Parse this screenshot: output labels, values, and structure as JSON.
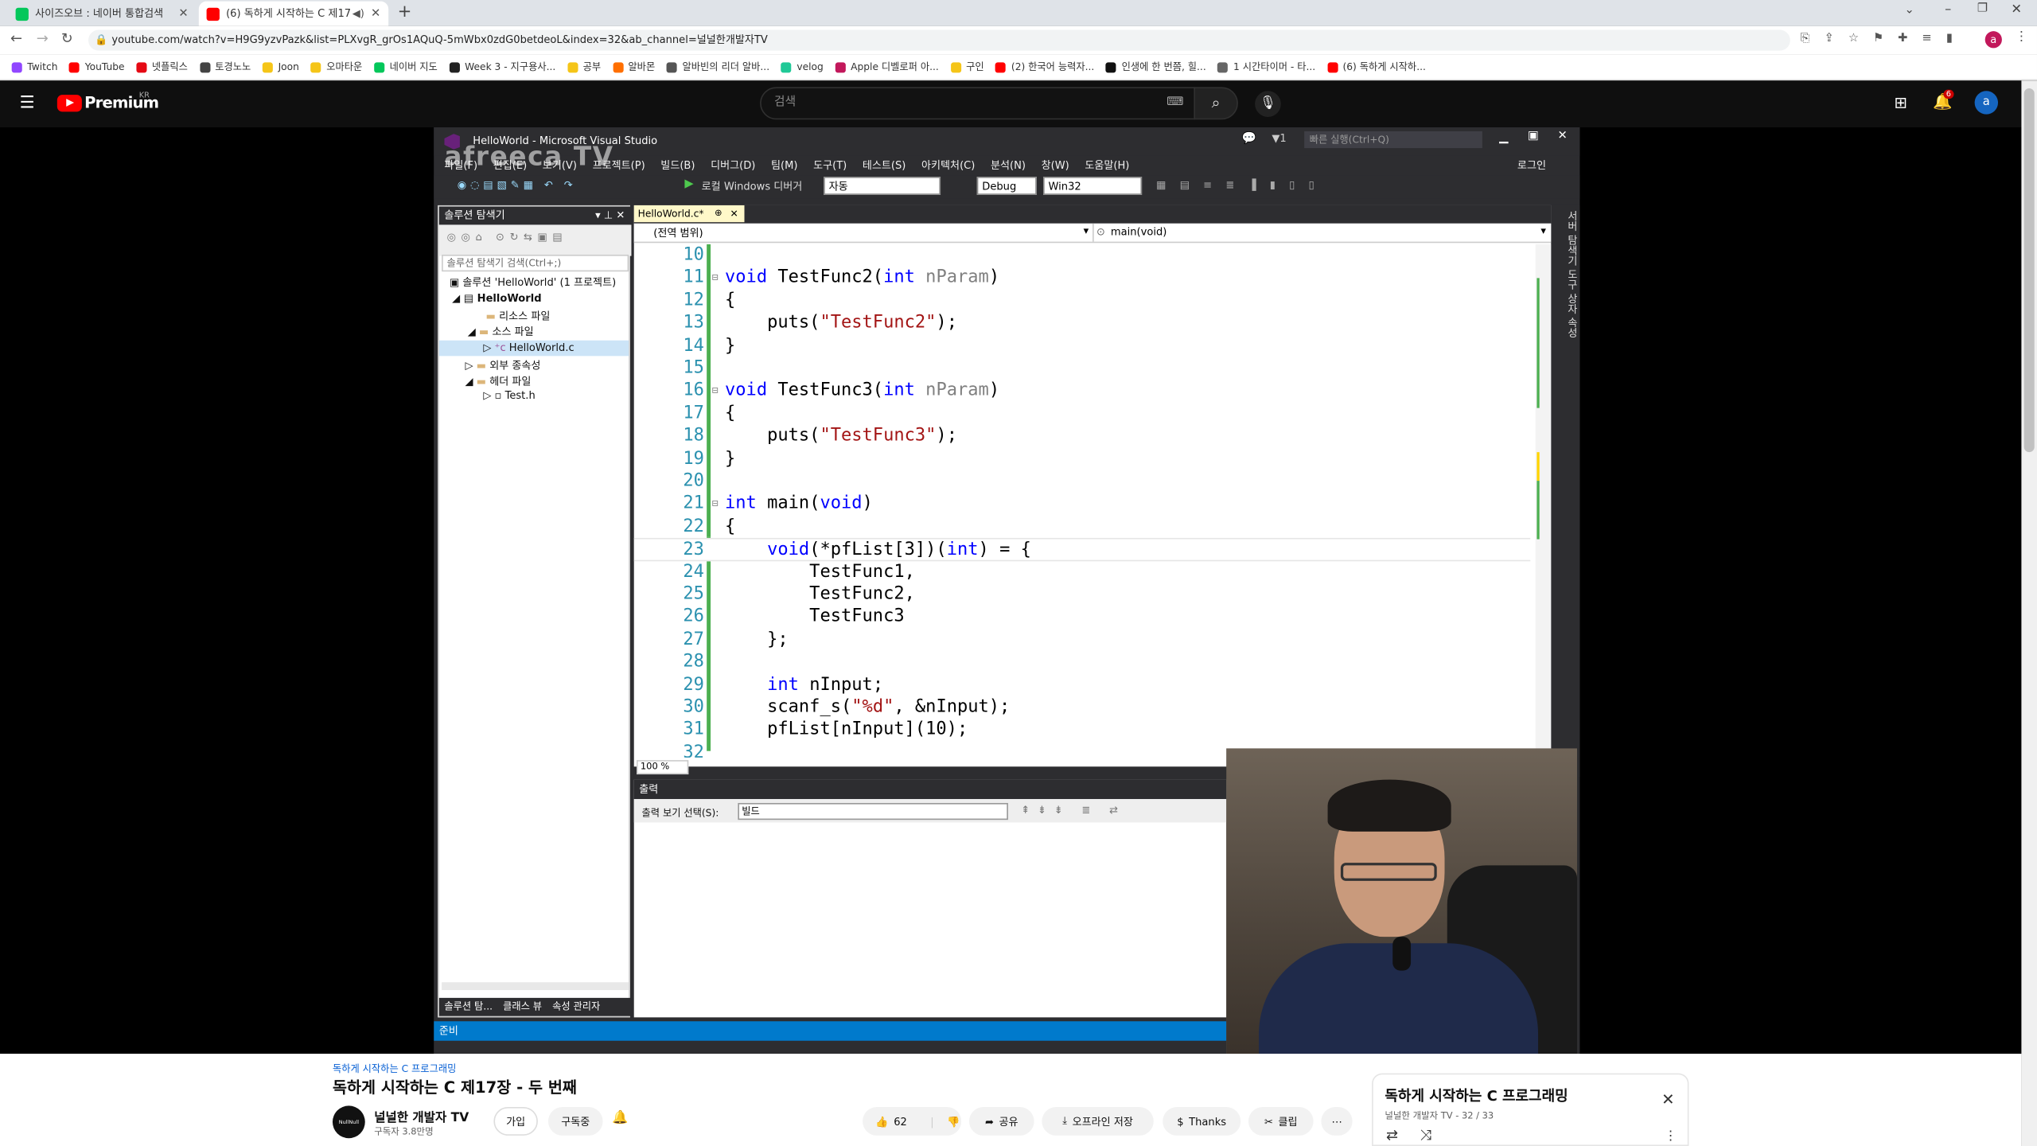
{
  "browser": {
    "tabs": [
      {
        "title": "사이즈오브 : 네이버 통합검색",
        "icon_color": "#03c75a"
      },
      {
        "title": "(6) 독하게 시작하는 C 제17",
        "icon_color": "#ff0000"
      }
    ],
    "url": "youtube.com/watch?v=H9G9yzvPazk&list=PLXvgR_grOs1AQuQ-5mWbx0zdG0betdeoL&index=32&ab_channel=널널한개발자TV",
    "bookmarks": [
      "Twitch",
      "YouTube",
      "넷플릭스",
      "토경노노",
      "Joon",
      "오마타운",
      "네이버 지도",
      "Week 3 - 지구용사...",
      "공부",
      "알바몬",
      "알바빈의 리더 알바...",
      "velog",
      "Apple 디벨로퍼 아...",
      "구인",
      "(2) 한국어 능력자...",
      "인생에 한 번쯤, 힐...",
      "1 시간타이머 - 타...",
      "(6) 독하게 시작하..."
    ]
  },
  "youtube": {
    "logo": "Premium",
    "region": "KR",
    "search_placeholder": "검색",
    "notif_count": "6",
    "avatar": "a"
  },
  "vs": {
    "title": "HelloWorld - Microsoft Visual Studio",
    "watermark": "afreeca TV",
    "quick_launch": "빠른 실행(Ctrl+Q)",
    "login": "로그인",
    "menus": [
      "파일(F)",
      "편집(E)",
      "보기(V)",
      "프로젝트(P)",
      "빌드(B)",
      "디버그(D)",
      "팀(M)",
      "도구(T)",
      "테스트(S)",
      "아키텍처(C)",
      "분석(N)",
      "창(W)",
      "도움말(H)"
    ],
    "toolbar": {
      "run": "로컬 Windows 디버거",
      "auto": "자동",
      "config": "Debug",
      "platform": "Win32"
    },
    "solution_explorer": {
      "title": "솔루션 탐색기",
      "search": "솔루션 탐색기 검색(Ctrl+;)",
      "items": [
        "솔루션 'HelloWorld' (1 프로젝트)",
        "HelloWorld",
        "리소스 파일",
        "소스 파일",
        "HelloWorld.c",
        "외부 종속성",
        "헤더 파일",
        "Test.h"
      ],
      "bottom_tabs": [
        "솔루션 탐...",
        "클래스 뷰",
        "속성 관리자"
      ]
    },
    "editor": {
      "tab": "HelloWorld.c*",
      "scope": "(전역 범위)",
      "func": "main(void)",
      "zoom": "100 %",
      "lines": [
        {
          "n": "10",
          "html": ""
        },
        {
          "n": "11",
          "html": "<span class=\"kw\">void</span> TestFunc2(<span class=\"kw\">int</span> <span class=\"pr\">nParam</span>)"
        },
        {
          "n": "12",
          "html": "{"
        },
        {
          "n": "13",
          "html": "    puts(<span class=\"st\">\"TestFunc2\"</span>);"
        },
        {
          "n": "14",
          "html": "}"
        },
        {
          "n": "15",
          "html": ""
        },
        {
          "n": "16",
          "html": "<span class=\"kw\">void</span> TestFunc3(<span class=\"kw\">int</span> <span class=\"pr\">nParam</span>)"
        },
        {
          "n": "17",
          "html": "{"
        },
        {
          "n": "18",
          "html": "    puts(<span class=\"st\">\"TestFunc3\"</span>);"
        },
        {
          "n": "19",
          "html": "}"
        },
        {
          "n": "20",
          "html": ""
        },
        {
          "n": "21",
          "html": "<span class=\"kw\">int</span> main(<span class=\"kw\">void</span>)"
        },
        {
          "n": "22",
          "html": "{"
        },
        {
          "n": "23",
          "html": "    <span class=\"kw\">void</span>(*pfList[3])(<span class=\"kw\">int</span>) = {"
        },
        {
          "n": "24",
          "html": "        TestFunc1,"
        },
        {
          "n": "25",
          "html": "        TestFunc2,"
        },
        {
          "n": "26",
          "html": "        TestFunc3"
        },
        {
          "n": "27",
          "html": "    };"
        },
        {
          "n": "28",
          "html": ""
        },
        {
          "n": "29",
          "html": "    <span class=\"kw\">int</span> nInput;"
        },
        {
          "n": "30",
          "html": "    scanf_s(<span class=\"st\">\"%d\"</span>, &amp;nInput);"
        },
        {
          "n": "31",
          "html": "    pfList[nInput](10);"
        },
        {
          "n": "32",
          "html": ""
        }
      ]
    },
    "output": {
      "title": "출력",
      "label": "출력 보기 선택(S):",
      "value": "빌드"
    },
    "status": "준비",
    "right_tabs": "서버 탐색기  도구 상자  속성"
  },
  "video": {
    "playlist_link": "독하게 시작하는 C 프로그래밍",
    "title": "독하게 시작하는 C 제17장 - 두 번째",
    "channel": "널널한 개발자 TV",
    "channel_avatar": "NullNull",
    "subscribers": "구독자 3.8만명",
    "join": "가입",
    "subscribed": "구독중",
    "likes": "62",
    "share": "공유",
    "download": "오프라인 저장",
    "thanks": "Thanks",
    "clip": "클립"
  },
  "playlist": {
    "title": "독하게 시작하는 C  프로그래밍",
    "meta": "널널한 개발자 TV - 32 / 33"
  }
}
